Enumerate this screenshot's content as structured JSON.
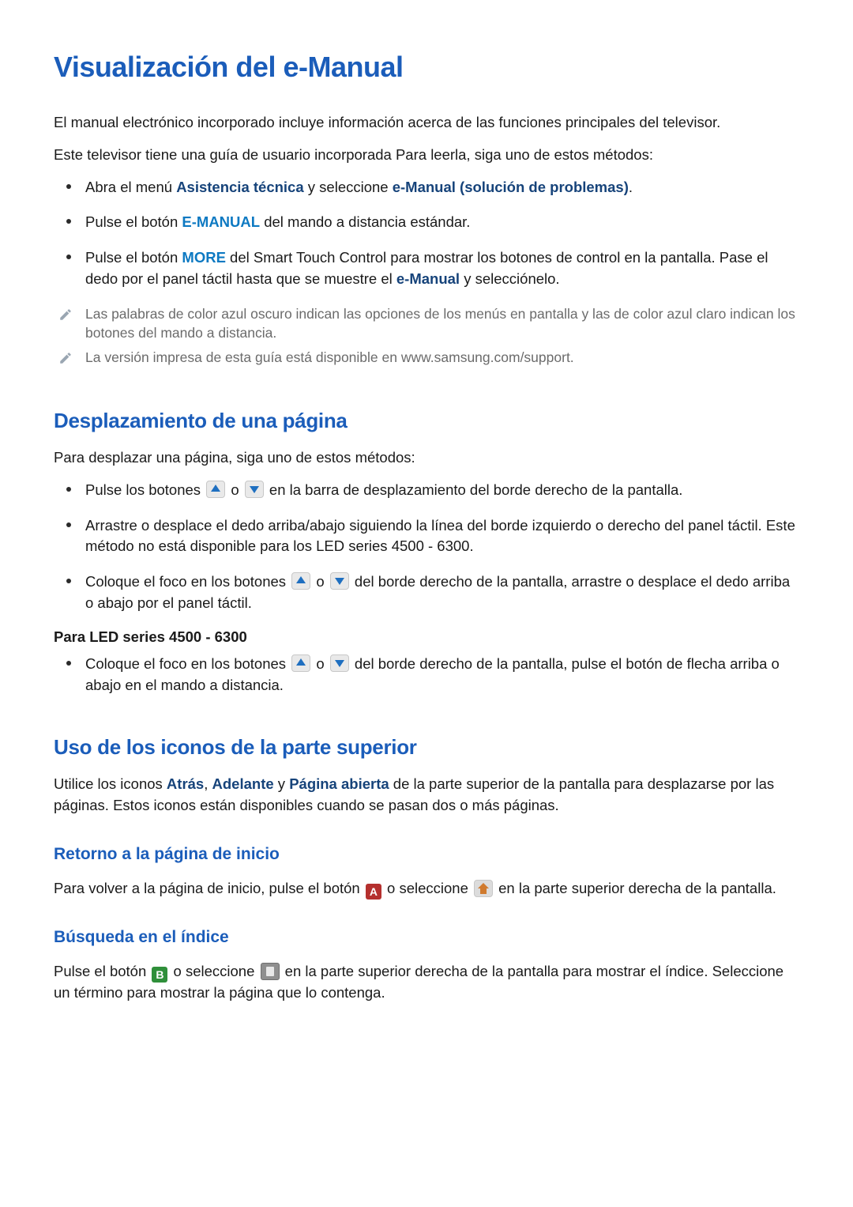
{
  "h1": "Visualización del e-Manual",
  "p1": "El manual electrónico incorporado incluye información acerca de las funciones principales del televisor.",
  "p2": "Este televisor tiene una guía de usuario incorporada Para leerla, siga uno de estos métodos:",
  "bl1": {
    "a": "Abra el menú ",
    "b": "Asistencia técnica",
    "c": " y seleccione ",
    "d": "e-Manual (solución de problemas)",
    "e": "."
  },
  "bl2": {
    "a": "Pulse el botón ",
    "b": "E-MANUAL",
    "c": " del mando a distancia estándar."
  },
  "bl3": {
    "a": "Pulse el botón ",
    "b": "MORE",
    "c": " del Smart Touch Control para mostrar los botones de control en la pantalla. Pase el dedo por el panel táctil hasta que se muestre el ",
    "d": "e-Manual",
    "e": " y selecciónelo."
  },
  "note1": "Las palabras de color azul oscuro indican las opciones de los menús en pantalla y las de color azul claro indican los botones del mando a distancia.",
  "note2": "La versión impresa de esta guía está disponible en www.samsung.com/support.",
  "h2a": "Desplazamiento de una página",
  "p3": "Para desplazar una página, siga uno de estos métodos:",
  "bl4": {
    "a": "Pulse los botones ",
    "b": " o ",
    "c": " en la barra de desplazamiento del borde derecho de la pantalla."
  },
  "bl5": "Arrastre o desplace el dedo arriba/abajo siguiendo la línea del borde izquierdo o derecho del panel táctil. Este método no está disponible para los LED series 4500 - 6300.",
  "bl6": {
    "a": "Coloque el foco en los botones ",
    "b": " o ",
    "c": " del borde derecho de la pantalla, arrastre o desplace el dedo arriba o abajo por el panel táctil."
  },
  "sub": "Para LED series 4500 - 6300",
  "bl7": {
    "a": "Coloque el foco en los botones ",
    "b": " o ",
    "c": " del borde derecho de la pantalla, pulse el botón de flecha arriba o abajo en el mando a distancia."
  },
  "h2b": "Uso de los iconos de la parte superior",
  "p4": {
    "a": "Utilice los iconos ",
    "b": "Atrás",
    "c": ", ",
    "d": "Adelante",
    "e": " y ",
    "f": "Página abierta",
    "g": " de la parte superior de la pantalla para desplazarse por las páginas. Estos iconos están disponibles cuando se pasan dos o más páginas."
  },
  "h3a": "Retorno a la página de inicio",
  "p5": {
    "a": "Para volver a la página de inicio, pulse el botón ",
    "b": " o seleccione ",
    "c": " en la parte superior derecha de la pantalla."
  },
  "h3b": "Búsqueda en el índice",
  "p6": {
    "a": "Pulse el botón ",
    "b": " o seleccione ",
    "c": " en la parte superior derecha de la pantalla para mostrar el índice. Seleccione un término para mostrar la página que lo contenga."
  },
  "letters": {
    "A": "A",
    "B": "B"
  }
}
